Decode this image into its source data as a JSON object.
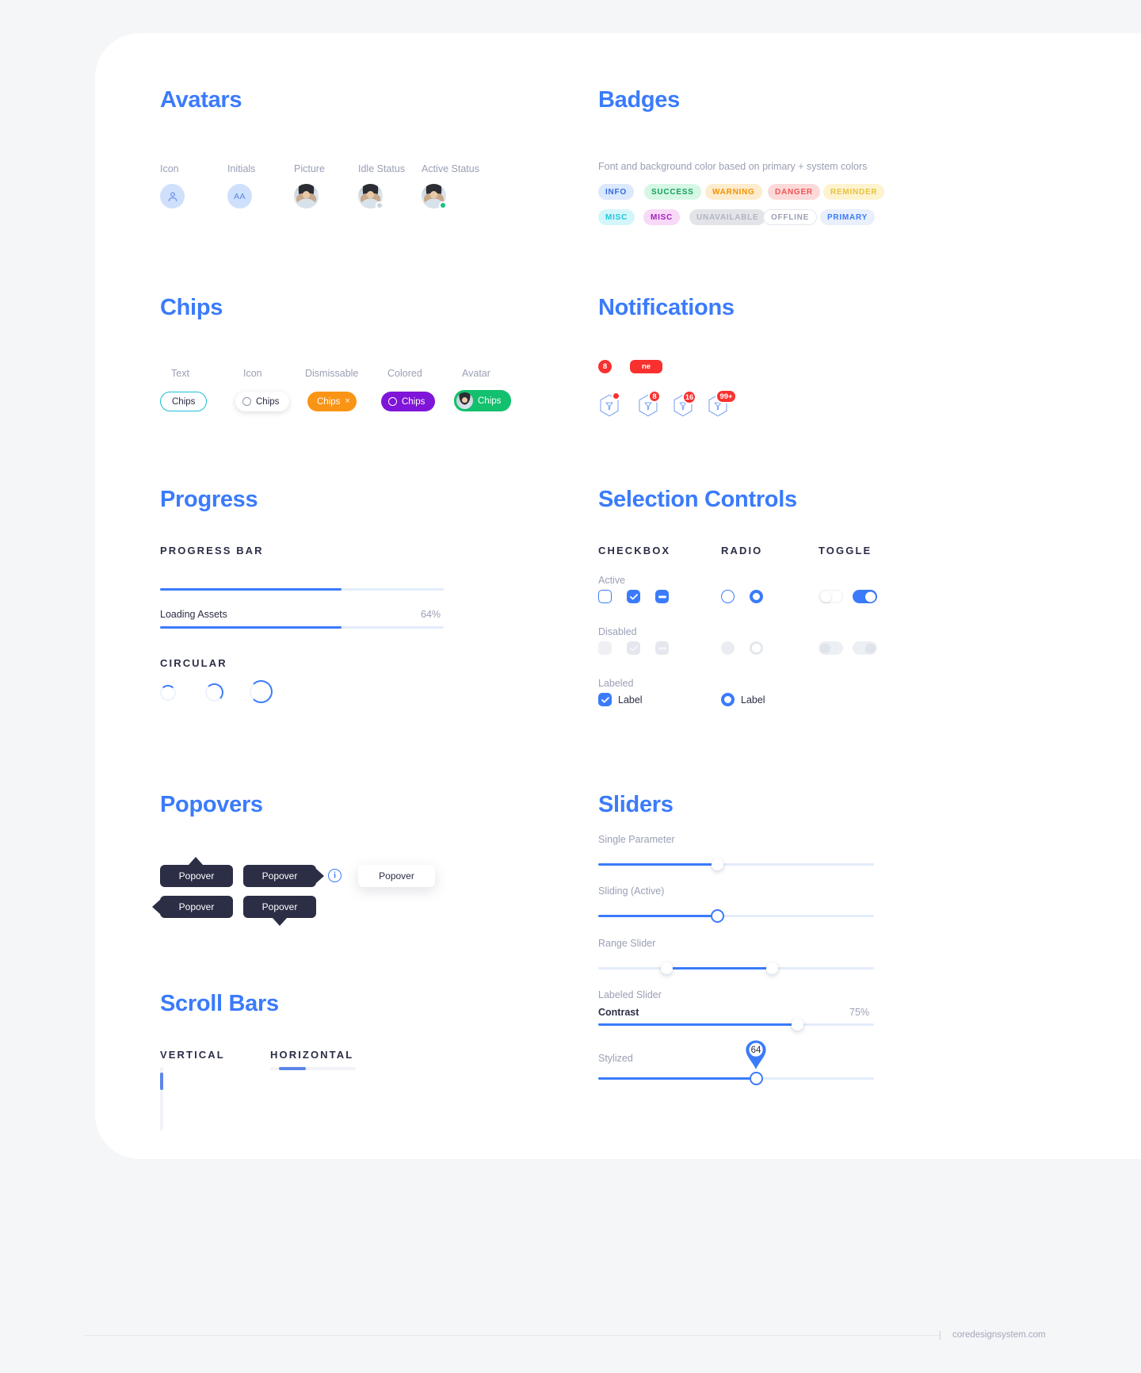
{
  "page": {
    "footer_text": "coredesignsystem.com"
  },
  "sections": {
    "avatars": {
      "title": "Avatars",
      "labels": [
        "Icon",
        "Initials",
        "Picture",
        "Idle Status",
        "Active Status"
      ],
      "initials": "AA",
      "idle_color": "#cfd3dd",
      "active_color": "#14c47d"
    },
    "badges": {
      "title": "Badges",
      "description": "Font and background color based on primary + system colors",
      "items": [
        {
          "label": "INFO",
          "bg": "#dce8fd",
          "fg": "#2f6ce0"
        },
        {
          "label": "SUCCESS",
          "bg": "#d6f7e4",
          "fg": "#15a05e"
        },
        {
          "label": "WARNING",
          "bg": "#fdeccd",
          "fg": "#f59200"
        },
        {
          "label": "DANGER",
          "bg": "#fcdada",
          "fg": "#f25353"
        },
        {
          "label": "REMINDER",
          "bg": "#fdf3cf",
          "fg": "#e8c33c"
        },
        {
          "label": "MISC",
          "bg": "#d4f6fa",
          "fg": "#1cc7dd"
        },
        {
          "label": "MISC",
          "bg": "#f8d9f7",
          "fg": "#a41fbf"
        },
        {
          "label": "UNAVAILABLE",
          "bg": "#e2e4e8",
          "fg": "#b0b5c0"
        },
        {
          "label": "OFFLINE",
          "bg": "#ffffff",
          "fg": "#9a9fb4"
        },
        {
          "label": "PRIMARY",
          "bg": "#e9effb",
          "fg": "#3b7bfb"
        }
      ]
    },
    "chips": {
      "title": "Chips",
      "labels": [
        "Text",
        "Icon",
        "Dismissable",
        "Colored",
        "Avatar"
      ],
      "items": [
        {
          "text": "Chips",
          "variant": "text",
          "accent": "#19c0d8"
        },
        {
          "text": "Chips",
          "variant": "icon",
          "accent": "#ffffff"
        },
        {
          "text": "Chips",
          "variant": "dismissable",
          "accent": "#f99415",
          "close": "×"
        },
        {
          "text": "Chips",
          "variant": "colored",
          "accent": "#7f15d8"
        },
        {
          "text": "Chips",
          "variant": "avatar",
          "accent": "#13c06e"
        }
      ]
    },
    "notifications": {
      "title": "Notifications",
      "standalone": [
        {
          "value": "8",
          "shape": "circle"
        },
        {
          "value": "ne",
          "shape": "pill"
        }
      ],
      "attached": [
        {
          "value": "",
          "shape": "dot"
        },
        {
          "value": "8",
          "shape": "circle"
        },
        {
          "value": "16",
          "shape": "circle"
        },
        {
          "value": "99+",
          "shape": "pill"
        }
      ],
      "color": "#f8312f"
    },
    "progress": {
      "title": "Progress",
      "bar_heading": "PROGRESS BAR",
      "circular_heading": "CIRCULAR",
      "bar_percent": 64,
      "labeled": {
        "label": "Loading Assets",
        "value": "64%",
        "percent": 64
      }
    },
    "selection": {
      "title": "Selection Controls",
      "columns": [
        "CHECKBOX",
        "RADIO",
        "TOGGLE"
      ],
      "rows": [
        "Active",
        "Disabled",
        "Labeled"
      ],
      "checkbox_label": "Label",
      "radio_label": "Label"
    },
    "popovers": {
      "title": "Popovers",
      "items": [
        {
          "text": "Popover",
          "tail": "up",
          "style": "dark"
        },
        {
          "text": "Popover",
          "tail": "right",
          "style": "dark"
        },
        {
          "text": "Popover",
          "tail": "none",
          "style": "light"
        },
        {
          "text": "Popover",
          "tail": "left",
          "style": "dark"
        },
        {
          "text": "Popover",
          "tail": "down",
          "style": "dark"
        }
      ],
      "info_glyph": "i"
    },
    "scrollbars": {
      "title": "Scroll Bars",
      "vertical_heading": "VERTICAL",
      "horizontal_heading": "HORIZONTAL"
    },
    "sliders": {
      "title": "Sliders",
      "items": [
        {
          "label": "Single Parameter",
          "percent": 43
        },
        {
          "label": "Sliding (Active)",
          "percent": 43
        },
        {
          "label": "Range Slider",
          "start": 25,
          "end": 63
        },
        {
          "label": "Labeled Slider",
          "sub_label": "Contrast",
          "value": "75%",
          "percent": 72
        },
        {
          "label": "Stylized",
          "value": "64",
          "percent": 57
        }
      ]
    }
  }
}
